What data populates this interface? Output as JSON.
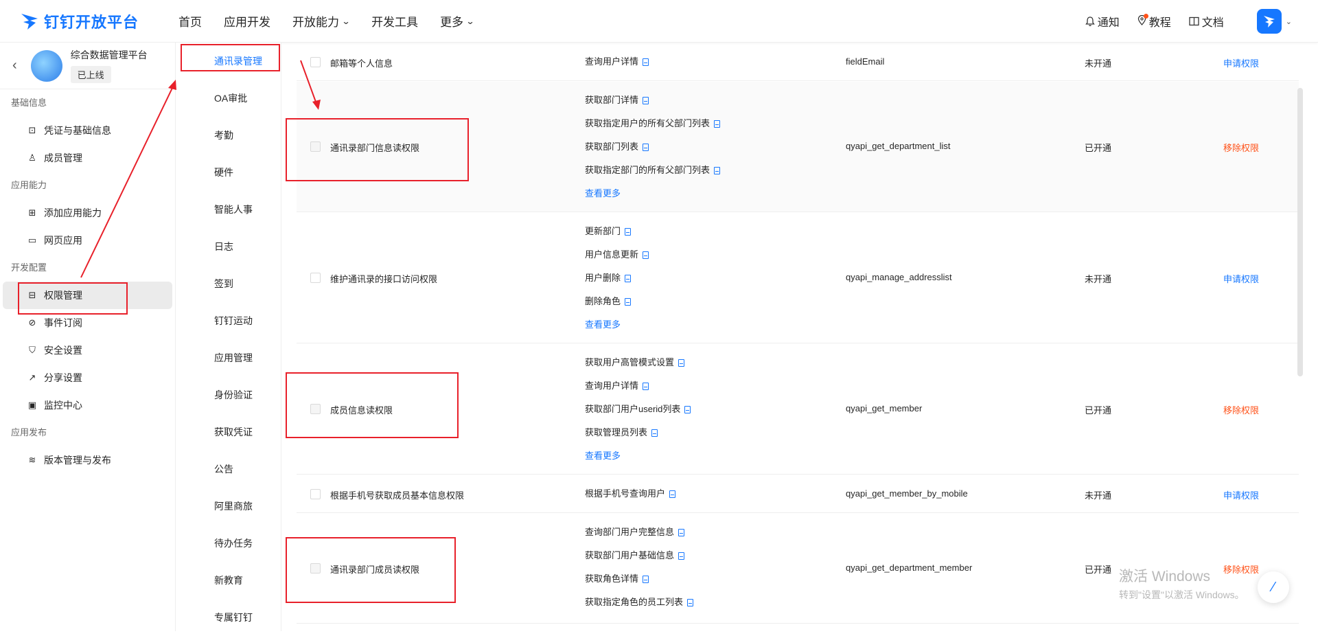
{
  "header": {
    "brand": "钉钉开放平台",
    "nav": [
      {
        "label": "首页",
        "dropdown": false
      },
      {
        "label": "应用开发",
        "dropdown": false
      },
      {
        "label": "开放能力",
        "dropdown": true
      },
      {
        "label": "开发工具",
        "dropdown": false
      },
      {
        "label": "更多",
        "dropdown": true
      }
    ],
    "right": {
      "notify": "通知",
      "tutorial": "教程",
      "docs": "文档"
    }
  },
  "sidebar": {
    "app_name": "综合数据管理平台",
    "app_status": "已上线",
    "groups": {
      "basic": "基础信息",
      "ability": "应用能力",
      "dev": "开发配置",
      "release": "应用发布"
    },
    "items": {
      "credentials": "凭证与基础信息",
      "members": "成员管理",
      "add_ability": "添加应用能力",
      "web_app": "网页应用",
      "permissions": "权限管理",
      "events": "事件订阅",
      "security": "安全设置",
      "share": "分享设置",
      "monitor": "监控中心",
      "versions": "版本管理与发布"
    }
  },
  "categories": [
    "通讯录管理",
    "OA审批",
    "考勤",
    "硬件",
    "智能人事",
    "日志",
    "签到",
    "钉钉运动",
    "应用管理",
    "身份验证",
    "获取凭证",
    "公告",
    "阿里商旅",
    "待办任务",
    "新教育",
    "专属钉钉"
  ],
  "permissions": [
    {
      "name": "邮箱等个人信息",
      "apis": [
        "查询用户详情"
      ],
      "more": "",
      "code": "fieldEmail",
      "status": "未开通",
      "action": "申请权限"
    },
    {
      "name": "通讯录部门信息读权限",
      "apis": [
        "获取部门详情",
        "获取指定用户的所有父部门列表",
        "获取部门列表",
        "获取指定部门的所有父部门列表"
      ],
      "more": "查看更多",
      "code": "qyapi_get_department_list",
      "status": "已开通",
      "action": "移除权限"
    },
    {
      "name": "维护通讯录的接口访问权限",
      "apis": [
        "更新部门",
        "用户信息更新",
        "用户删除",
        "删除角色"
      ],
      "more": "查看更多",
      "code": "qyapi_manage_addresslist",
      "status": "未开通",
      "action": "申请权限"
    },
    {
      "name": "成员信息读权限",
      "apis": [
        "获取用户高管模式设置",
        "查询用户详情",
        "获取部门用户userid列表",
        "获取管理员列表"
      ],
      "more": "查看更多",
      "code": "qyapi_get_member",
      "status": "已开通",
      "action": "移除权限"
    },
    {
      "name": "根据手机号获取成员基本信息权限",
      "apis": [
        "根据手机号查询用户"
      ],
      "more": "",
      "code": "qyapi_get_member_by_mobile",
      "status": "未开通",
      "action": "申请权限"
    },
    {
      "name": "通讯录部门成员读权限",
      "apis": [
        "查询部门用户完整信息",
        "获取部门用户基础信息",
        "获取角色详情",
        "获取指定角色的员工列表"
      ],
      "more": "",
      "code": "qyapi_get_department_member",
      "status": "已开通",
      "action": "移除权限"
    }
  ],
  "watermark": {
    "line1": "激活 Windows",
    "line2": "转到\"设置\"以激活 Windows。"
  },
  "colors": {
    "accent": "#1677ff",
    "danger": "#ff5219",
    "annotation": "#e8202a"
  }
}
